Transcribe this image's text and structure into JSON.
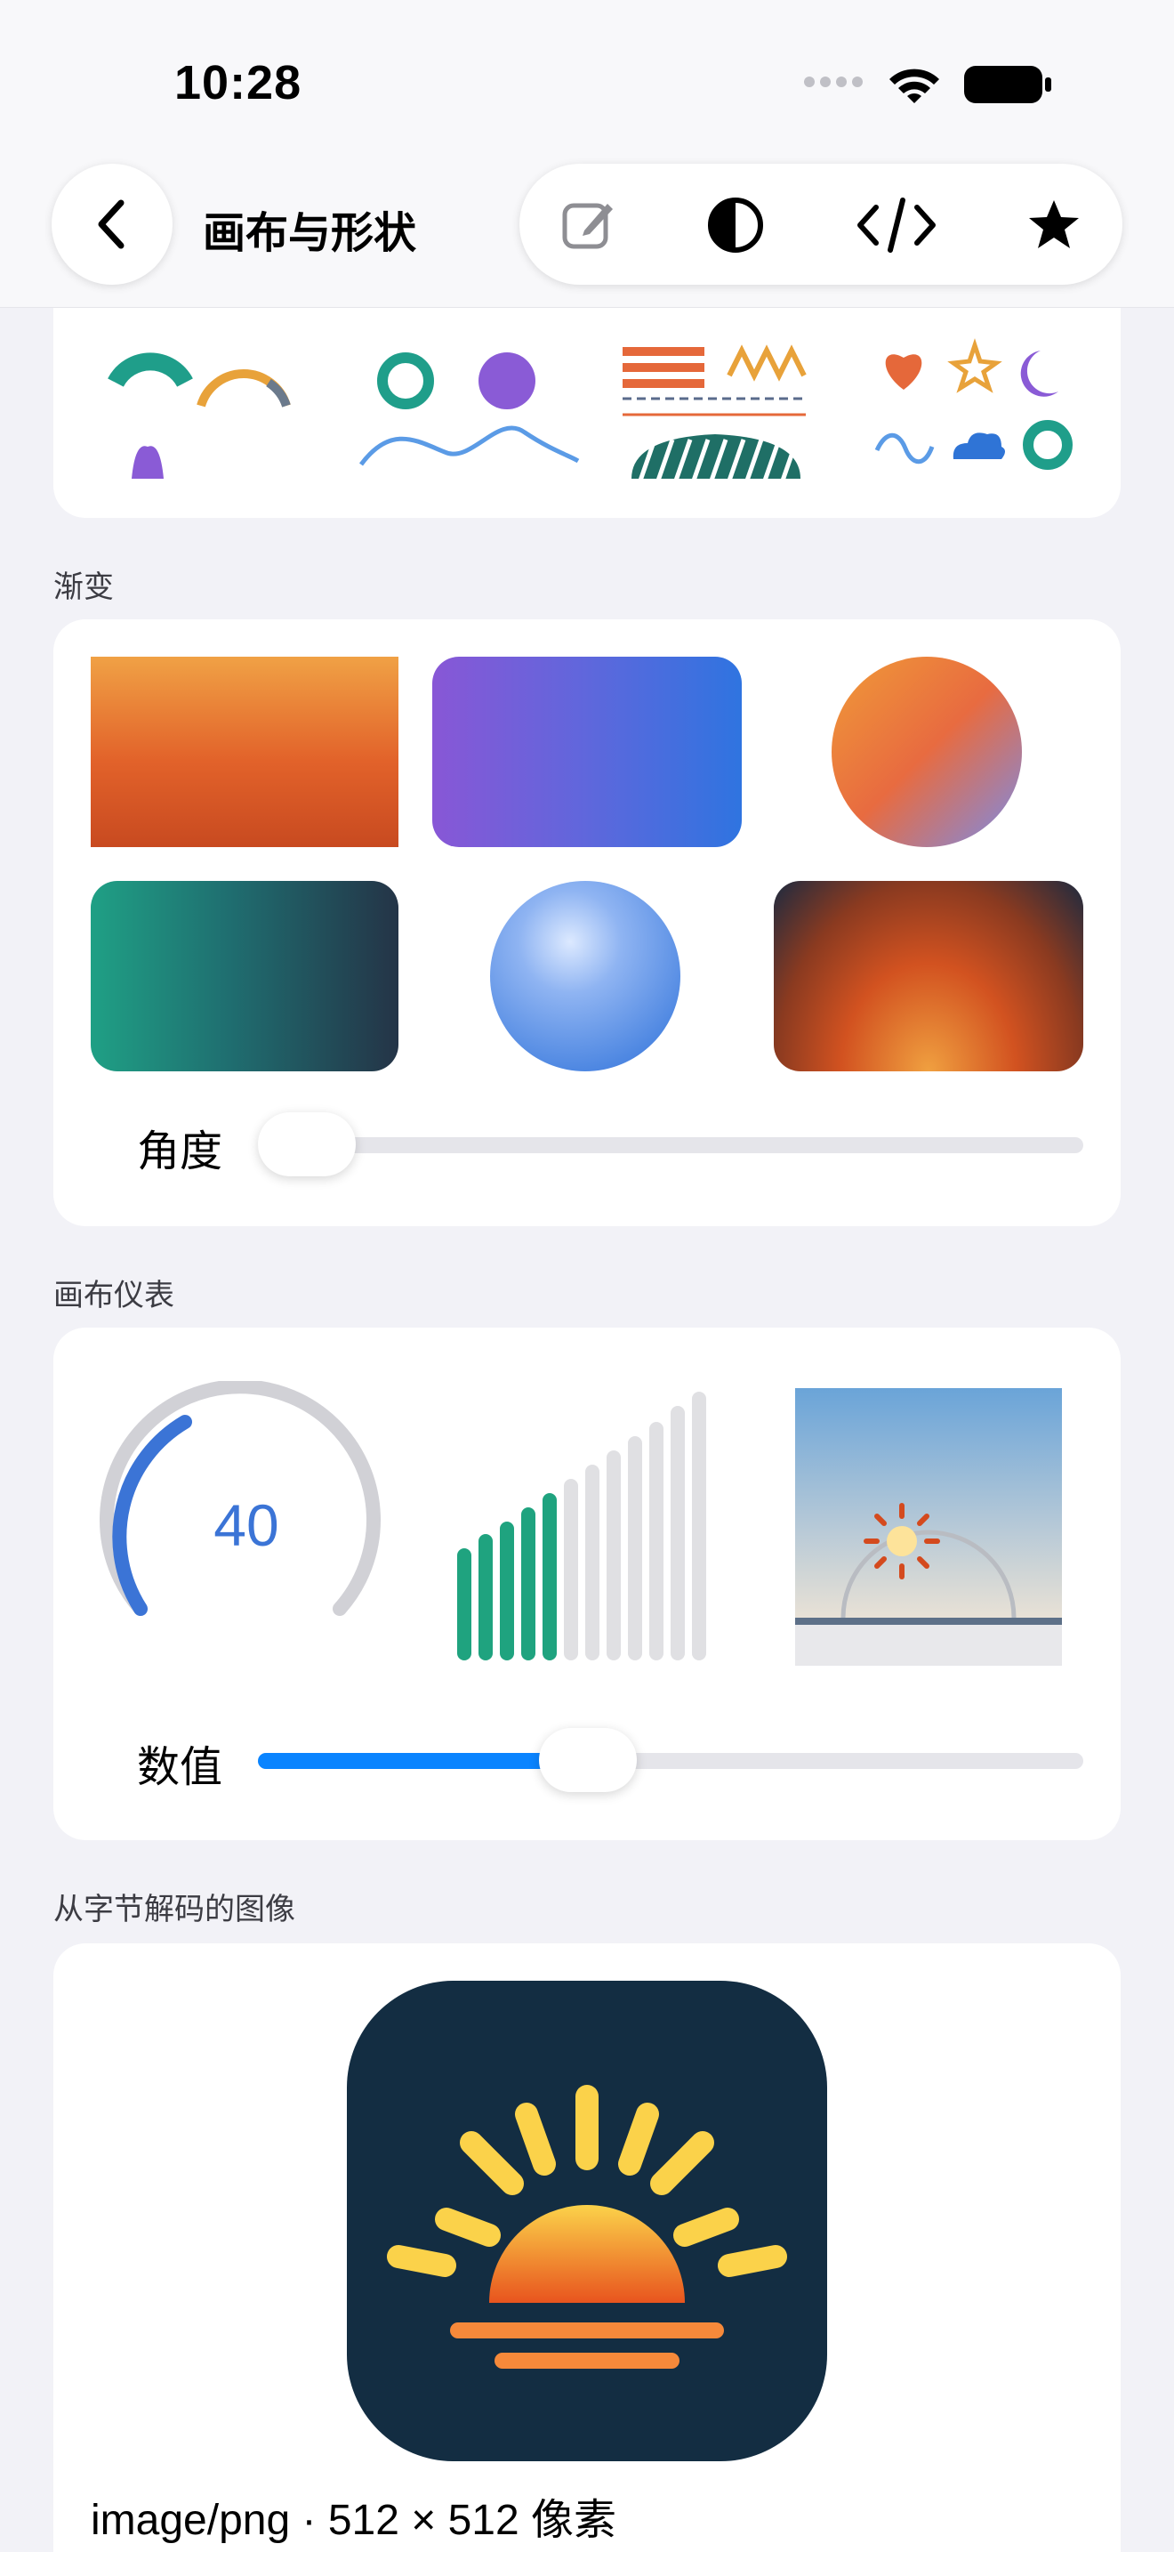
{
  "status_bar": {
    "time": "10:28"
  },
  "nav": {
    "title": "画布与形状",
    "toolbar": [
      {
        "name": "edit-icon"
      },
      {
        "name": "contrast-icon"
      },
      {
        "name": "code-icon"
      },
      {
        "name": "star-icon"
      }
    ]
  },
  "sections": {
    "gradients": {
      "label": "渐变",
      "angle_label": "角度",
      "angle_value": 0
    },
    "gauges": {
      "label": "画布仪表",
      "ring_value": "40",
      "value_label": "数值",
      "value_fraction": 0.4
    },
    "decoded_image": {
      "label": "从字节解码的图像",
      "caption": "image/png · 512 × 512 像素"
    }
  },
  "colors": {
    "accent": "#0a84ff",
    "ring_blue": "#3b74d6",
    "bar_green": "#1fa37f",
    "icon_bg": "#132d42"
  }
}
